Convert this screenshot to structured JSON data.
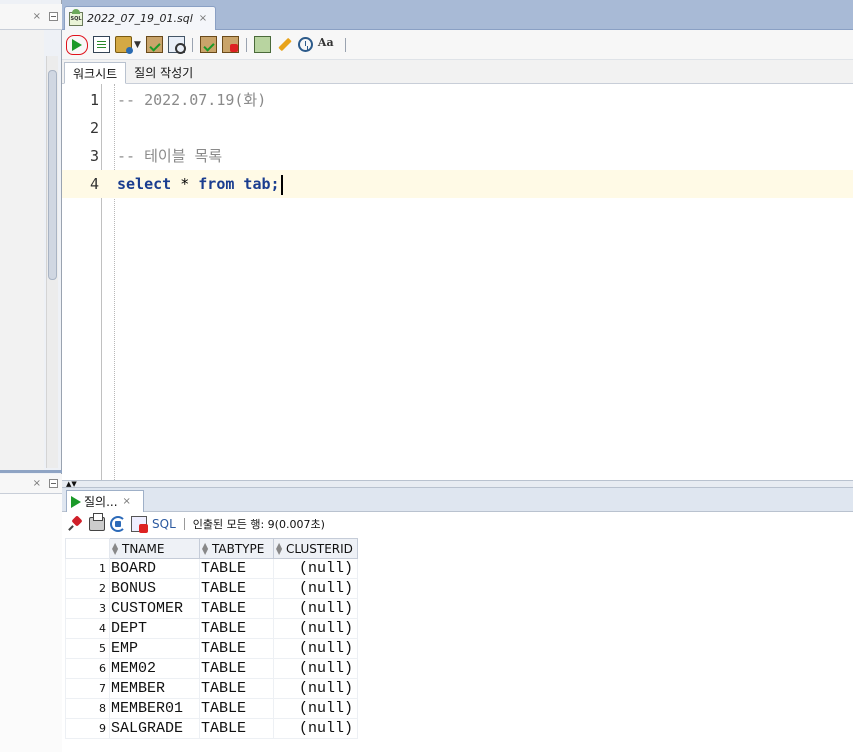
{
  "editor_tab": {
    "filename": "2022_07_19_01.sql",
    "close": "×"
  },
  "left_panel": {
    "close": "×"
  },
  "toolbar": {
    "run_statement": "run-statement",
    "run_script": "run-script",
    "autotrace": "autotrace",
    "explain_plan": "explain-plan",
    "commit": "commit",
    "rollback": "rollback",
    "sql_tuning": "sql-tuning-advisor",
    "clear": "clear",
    "history": "sql-history",
    "format": "Aa"
  },
  "subtabs": [
    "워크시트",
    "질의 작성기"
  ],
  "editor": {
    "lines": [
      {
        "no": "1",
        "text": "-- 2022.07.19(화)"
      },
      {
        "no": "2",
        "text": ""
      },
      {
        "no": "3",
        "text": "-- 테이블 목록"
      },
      {
        "no": "4",
        "kw1": "select",
        "star": " * ",
        "kw2": "from",
        "rest": " tab;"
      }
    ]
  },
  "results": {
    "tab_label": "질의...",
    "tab_close": "×",
    "sql_label": "SQL",
    "status": "인출된 모든 행: 9(0.007초)",
    "columns": [
      "TNAME",
      "TABTYPE",
      "CLUSTERID"
    ],
    "rows": [
      [
        "1",
        "BOARD",
        "TABLE",
        "(null)"
      ],
      [
        "2",
        "BONUS",
        "TABLE",
        "(null)"
      ],
      [
        "3",
        "CUSTOMER",
        "TABLE",
        "(null)"
      ],
      [
        "4",
        "DEPT",
        "TABLE",
        "(null)"
      ],
      [
        "5",
        "EMP",
        "TABLE",
        "(null)"
      ],
      [
        "6",
        "MEM02",
        "TABLE",
        "(null)"
      ],
      [
        "7",
        "MEMBER",
        "TABLE",
        "(null)"
      ],
      [
        "8",
        "MEMBER01",
        "TABLE",
        "(null)"
      ],
      [
        "9",
        "SALGRADE",
        "TABLE",
        "(null)"
      ]
    ]
  },
  "colors": {
    "run_green": "#1b9a29",
    "annotation_red": "#e0121b",
    "keyword_blue": "#1a3d8f",
    "current_line": "#fffae6",
    "tabstrip_blue": "#a8bad6"
  }
}
